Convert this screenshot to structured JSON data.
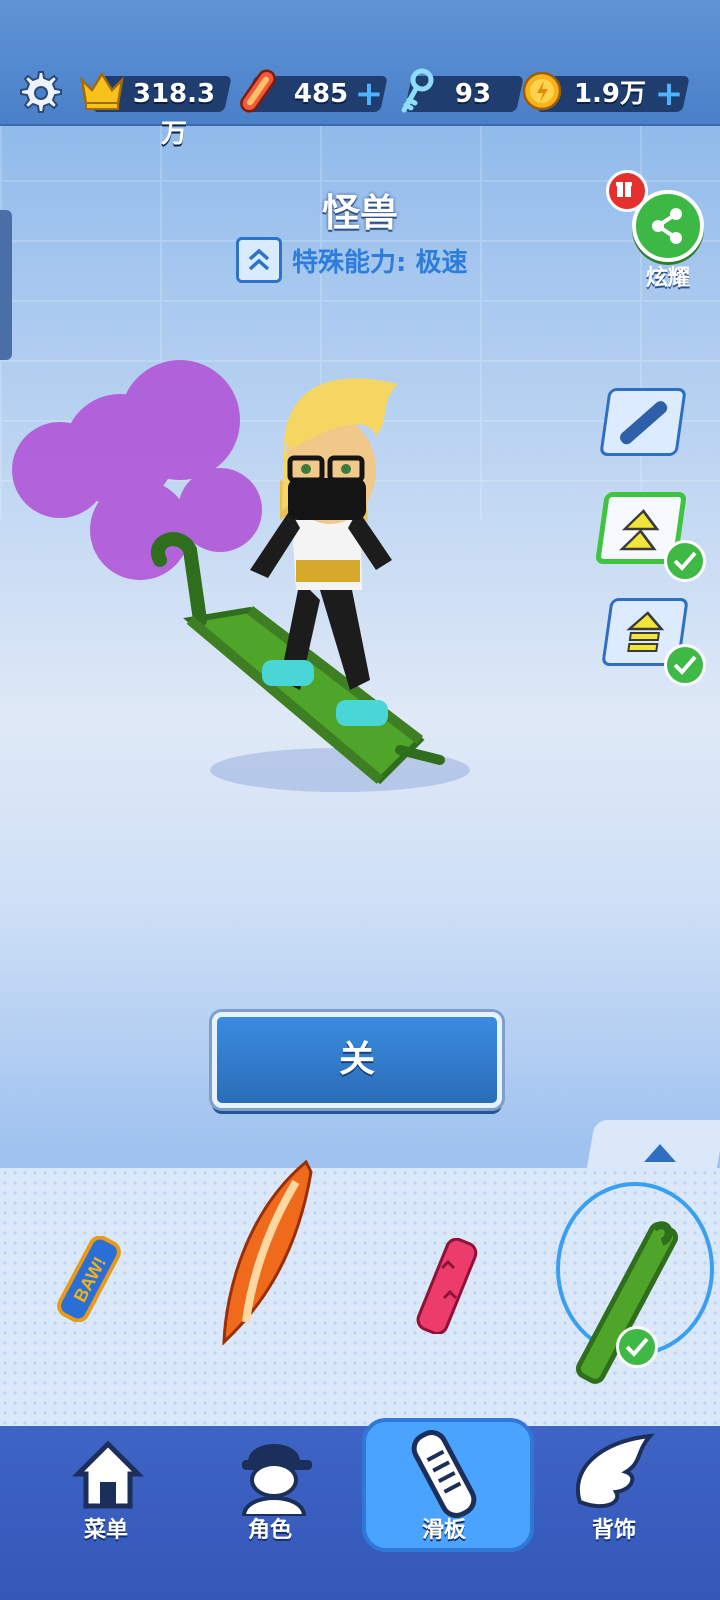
{
  "topbar": {
    "score": "318.3万",
    "boards": "485",
    "keys": "93",
    "coins": "1.9万",
    "plus_symbol": "+"
  },
  "board": {
    "name": "怪兽",
    "ability": "特殊能力: 极速"
  },
  "share": {
    "label": "炫耀"
  },
  "action": {
    "label": "关"
  },
  "nav": {
    "items": [
      {
        "label": "菜单",
        "icon": "home-icon"
      },
      {
        "label": "角色",
        "icon": "character-icon"
      },
      {
        "label": "滑板",
        "icon": "hoverboard-icon",
        "active": true
      },
      {
        "label": "背饰",
        "icon": "wings-icon"
      }
    ]
  },
  "boards_list": [
    {
      "icon": "baw-board-icon",
      "baw_text": "BAW!"
    },
    {
      "icon": "flame-surfboard-icon"
    },
    {
      "icon": "palm-board-icon"
    },
    {
      "icon": "monster-board-icon",
      "selected": true
    }
  ],
  "colors": {
    "accent": "#3fb845",
    "topbar": "#4a80c8",
    "nav": "#3458b8"
  }
}
